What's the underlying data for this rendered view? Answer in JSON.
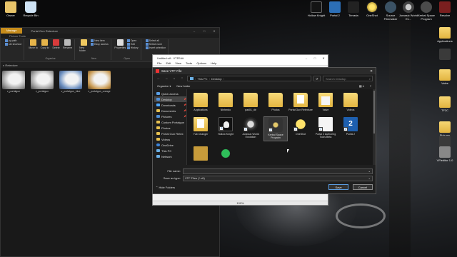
{
  "desktop": {
    "left_icons": [
      {
        "label": "Owner",
        "icon": "user-folder-icon"
      },
      {
        "label": "Recycle Bin",
        "icon": "recycle-bin-icon"
      }
    ],
    "top_icons": [
      {
        "label": "Hollow Knight",
        "icon": "hollow-knight-icon"
      },
      {
        "label": "Portal 2",
        "icon": "portal2-icon"
      },
      {
        "label": "Terraria",
        "icon": "terraria-icon"
      },
      {
        "label": "OneShot",
        "icon": "oneshot-icon"
      },
      {
        "label": "Source Filmmaker",
        "icon": "sfm-icon"
      },
      {
        "label": "Jurassic World Ev...",
        "icon": "jwe-icon"
      },
      {
        "label": "Kerbal Space Program",
        "icon": "ksp-icon"
      },
      {
        "label": "Resolve",
        "icon": "resolve-icon"
      }
    ],
    "right_icons": [
      {
        "label": "Applications",
        "icon": "folder-icon"
      },
      {
        "label": "",
        "icon": "app-icon"
      },
      {
        "label": "Valve",
        "icon": "folder-icon"
      },
      {
        "label": "TF2C",
        "icon": "folder-icon"
      },
      {
        "label": "Pictures",
        "icon": "folder-icon"
      },
      {
        "label": "",
        "icon": "app-icon"
      },
      {
        "label": "VFleditor 1.0",
        "icon": "vf-icon"
      }
    ]
  },
  "explorer": {
    "manage_tab": "Manage",
    "title": "Portal Gun Retexture",
    "subtab": "Picture Tools",
    "ribbon": {
      "clipboard": {
        "items": [
          "py path",
          "ste shortcut"
        ],
        "buttons": [
          "Move to",
          "Copy to",
          "Delete",
          "Rename",
          "New folder"
        ],
        "new_list": [
          "New item",
          "Easy access"
        ],
        "open_buttons": [
          "Properties"
        ],
        "open_list": [
          "Open",
          "Edit",
          "History"
        ],
        "select_list": [
          "Select all",
          "Select none",
          "Invert selection"
        ]
      },
      "group_names": [
        "Organize",
        "New",
        "Open",
        "Select"
      ]
    },
    "address": "n Retexture",
    "files": [
      {
        "name": "v_portalgun",
        "tint": "gray"
      },
      {
        "name": "v_portalgun",
        "tint": "gray"
      },
      {
        "name": "v_portalgun_blue",
        "tint": "blue"
      },
      {
        "name": "v_portalgun_orange",
        "tint": "orange"
      }
    ]
  },
  "vtfedit": {
    "title": "Untitled.vtf - VTFEdit",
    "menu": [
      "File",
      "Edit",
      "View",
      "Tools",
      "Options",
      "Help"
    ],
    "zoom": "100%"
  },
  "dialog": {
    "title": "Save VTF File",
    "path": [
      "This PC",
      "Desktop"
    ],
    "search_placeholder": "Search Desktop",
    "organize": "Organize ▾",
    "new_folder": "New folder",
    "nav": [
      {
        "label": "Quick access",
        "icon": "star-icon",
        "pinned": false,
        "selected": false
      },
      {
        "label": "Desktop",
        "icon": "desktop-icon",
        "pinned": true,
        "selected": true
      },
      {
        "label": "Downloads",
        "icon": "download-icon",
        "pinned": true,
        "selected": false
      },
      {
        "label": "Documents",
        "icon": "documents-icon",
        "pinned": true,
        "selected": false
      },
      {
        "label": "Pictures",
        "icon": "pictures-icon",
        "pinned": true,
        "selected": false
      },
      {
        "label": "Custom Portalgun",
        "icon": "folder-icon",
        "pinned": false,
        "selected": false
      },
      {
        "label": "Photos",
        "icon": "folder-icon",
        "pinned": false,
        "selected": false
      },
      {
        "label": "Portal Gun Retex",
        "icon": "folder-icon",
        "pinned": false,
        "selected": false
      },
      {
        "label": "Videos",
        "icon": "folder-icon",
        "pinned": false,
        "selected": false
      },
      {
        "label": "OneDrive",
        "icon": "onedrive-icon",
        "pinned": false,
        "selected": false
      },
      {
        "label": "This PC",
        "icon": "this-pc-icon",
        "pinned": false,
        "selected": false
      },
      {
        "label": "Network",
        "icon": "network-icon",
        "pinned": false,
        "selected": false
      }
    ],
    "files": [
      {
        "name": "Applications",
        "icon": "folder",
        "shortcut": false
      },
      {
        "name": "Nintendo",
        "icon": "folder",
        "shortcut": false
      },
      {
        "name": "pak01_dir",
        "icon": "folder",
        "shortcut": false
      },
      {
        "name": "Photos",
        "icon": "folder",
        "shortcut": false
      },
      {
        "name": "Portal Gun Retexture",
        "icon": "folder-doc",
        "shortcut": false
      },
      {
        "name": "Valve",
        "icon": "valve",
        "shortcut": false
      },
      {
        "name": "Videos",
        "icon": "folder",
        "shortcut": false
      },
      {
        "name": "Yub Changer",
        "icon": "folder-doc",
        "shortcut": false
      },
      {
        "name": "Hollow Knight",
        "icon": "hk",
        "shortcut": true
      },
      {
        "name": "Jurassic World Evolution",
        "icon": "jwe",
        "shortcut": true
      },
      {
        "name": "Kerbal Space Program",
        "icon": "ksp",
        "shortcut": true,
        "selected": true
      },
      {
        "name": "OneShot",
        "icon": "one",
        "shortcut": true
      },
      {
        "name": "Portal 2 Authoring Tools Beta",
        "icon": "paper",
        "shortcut": true
      },
      {
        "name": "Portal 2",
        "icon": "p2",
        "shortcut": true
      },
      {
        "name": "",
        "icon": "gold",
        "shortcut": false
      },
      {
        "name": "",
        "icon": "green",
        "shortcut": false
      }
    ],
    "file_name_label": "File name:",
    "file_name_value": "",
    "save_type_label": "Save as type:",
    "save_type_value": "VTF Files (*.vtf)",
    "hide_folders": "Hide Folders",
    "save_button": "Save",
    "cancel_button": "Cancel"
  }
}
